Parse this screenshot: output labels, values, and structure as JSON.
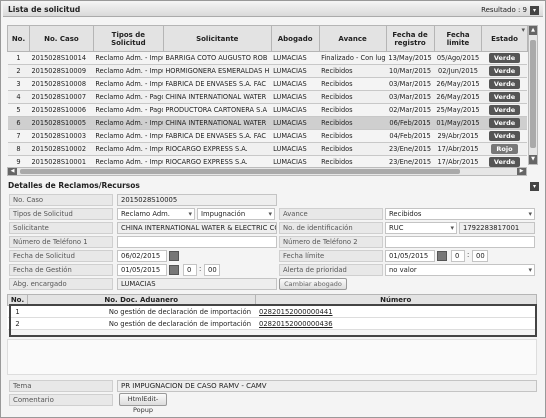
{
  "list_panel": {
    "title": "Lista de solicitud",
    "result_label": "Resultado : 9"
  },
  "columns": [
    "No.",
    "No. Caso",
    "Tipos de Solicitud",
    "Solicitante",
    "Abogado",
    "Avance",
    "Fecha de registro",
    "Fecha limite",
    "Estado"
  ],
  "rows": [
    {
      "no": "1",
      "caso": "2015028S10014",
      "tipo": "Reclamo Adm. - Impug",
      "sol": "BARRIGA COTO AUGUSTO ROB",
      "abo": "LUMACIAS",
      "av": "Finalizado - Con lugar",
      "reg": "13/May/2015",
      "lim": "05/Ago/2015",
      "est": "Verde"
    },
    {
      "no": "2",
      "caso": "2015028S10009",
      "tipo": "Reclamo Adm. - Impug",
      "sol": "HORMIGONERA ESMERALDAS H",
      "abo": "LUMACIAS",
      "av": "Recibidos",
      "reg": "10/Mar/2015",
      "lim": "02/Jun/2015",
      "est": "Verde"
    },
    {
      "no": "3",
      "caso": "2015028S10008",
      "tipo": "Reclamo Adm. - Impug",
      "sol": "FABRICA DE ENVASES S.A. FAC",
      "abo": "LUMACIAS",
      "av": "Recibidos",
      "reg": "03/Mar/2015",
      "lim": "26/May/2015",
      "est": "Verde"
    },
    {
      "no": "4",
      "caso": "2015028S10007",
      "tipo": "Reclamo Adm. - Pago",
      "sol": "CHINA INTERNATIONAL WATER",
      "abo": "LUMACIAS",
      "av": "Recibidos",
      "reg": "03/Mar/2015",
      "lim": "26/May/2015",
      "est": "Verde"
    },
    {
      "no": "5",
      "caso": "2015028S10006",
      "tipo": "Reclamo Adm. - Pago",
      "sol": "PRODUCTORA CARTONERA S.A",
      "abo": "LUMACIAS",
      "av": "Recibidos",
      "reg": "02/Mar/2015",
      "lim": "25/May/2015",
      "est": "Verde"
    },
    {
      "no": "6",
      "caso": "2015028S10005",
      "tipo": "Reclamo Adm. - Impug",
      "sol": "CHINA INTERNATIONAL WATER",
      "abo": "LUMACIAS",
      "av": "Recibidos",
      "reg": "06/Feb/2015",
      "lim": "01/May/2015",
      "est": "Verde"
    },
    {
      "no": "7",
      "caso": "2015028S10003",
      "tipo": "Reclamo Adm. - Impug",
      "sol": "FABRICA DE ENVASES S.A. FAC",
      "abo": "LUMACIAS",
      "av": "Recibidos",
      "reg": "04/Feb/2015",
      "lim": "29/Abr/2015",
      "est": "Verde"
    },
    {
      "no": "8",
      "caso": "2015028S10002",
      "tipo": "Reclamo Adm. - Impug",
      "sol": "RIOCARGO EXPRESS S.A.",
      "abo": "LUMACIAS",
      "av": "Recibidos",
      "reg": "23/Ene/2015",
      "lim": "17/Abr/2015",
      "est": "Rojo"
    },
    {
      "no": "9",
      "caso": "2015028S10001",
      "tipo": "Reclamo Adm. - Impug",
      "sol": "RIOCARGO EXPRESS S.A.",
      "abo": "LUMACIAS",
      "av": "Recibidos",
      "reg": "23/Ene/2015",
      "lim": "17/Abr/2015",
      "est": "Verde"
    }
  ],
  "details": {
    "title": "Detalles de Reclamos/Recursos",
    "no_caso_label": "No. Caso",
    "no_caso": "2015028S10005",
    "tipos_label": "Tipos de Solicitud",
    "tipo1": "Reclamo Adm.",
    "tipo2": "Impugnación",
    "avance_label": "Avance",
    "avance": "Recibidos",
    "solicitante_label": "Solicitante",
    "solicitante": "CHINA INTERNATIONAL WATER & ELECTRIC CO",
    "ident_label": "No. de identificación",
    "ident_type": "RUC",
    "ident_num": "1792283817001",
    "tel1_label": "Número de Teléfono 1",
    "tel2_label": "Número de Teléfono 2",
    "fsol_label": "Fecha de Solicitud",
    "fsol": "06/02/2015",
    "flim_label": "Fecha límite",
    "flim": "01/05/2015",
    "flim_h": "0",
    "flim_m": "00",
    "fges_label": "Fecha de Gestión",
    "fges": "01/05/2015",
    "fges_h": "0",
    "fges_m": "00",
    "alerta_label": "Alerta de prioridad",
    "alerta": "no valor",
    "abg_label": "Abg. encargado",
    "abg": "LUMACIAS",
    "cambiar_btn": "Cambiar abogado"
  },
  "docs": {
    "columns": [
      "No.",
      "No. Doc. Aduanero",
      "Número"
    ],
    "rows": [
      {
        "no": "1",
        "doc": "No gestión de declaración de importación",
        "num": "02820152000000441"
      },
      {
        "no": "2",
        "doc": "No gestión de declaración de importación",
        "num": "02820152000000436"
      }
    ]
  },
  "footer": {
    "tema_label": "Tema",
    "tema": "PR IMPUGNACION DE CASO RAMV - CAMV",
    "coment_label": "Comentario",
    "html_btn": "HtmlEdit-Popup"
  }
}
